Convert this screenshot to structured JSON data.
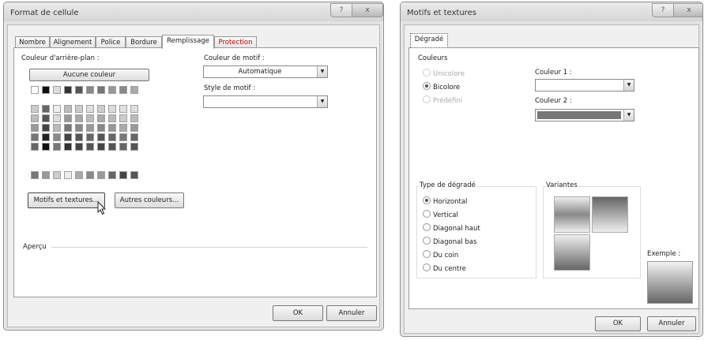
{
  "left_dialog": {
    "title": "Format de cellule",
    "help": "?",
    "close": "x",
    "tabs": [
      "Nombre",
      "Alignement",
      "Police",
      "Bordure",
      "Remplissage",
      "Protection"
    ],
    "bg_color_label": "Couleur d'arrière-plan :",
    "no_color_button": "Aucune couleur",
    "pattern_color_label": "Couleur de motif :",
    "pattern_color_value": "Automatique",
    "pattern_style_label": "Style de motif :",
    "pattern_style_value": "",
    "fill_effects_button": "Motifs et textures...",
    "more_colors_button": "Autres couleurs...",
    "preview_label": "Aperçu",
    "ok": "OK",
    "cancel": "Annuler"
  },
  "right_dialog": {
    "title": "Motifs et textures",
    "help": "?",
    "close": "x",
    "tab": "Dégradé",
    "colors_group": "Couleurs",
    "one_color": "Unicolore",
    "two_colors": "Bicolore",
    "preset": "Prédéfini",
    "color1_label": "Couleur 1 :",
    "color2_label": "Couleur 2 :",
    "shading_group": "Type de dégradé",
    "shading_styles": [
      "Horizontal",
      "Vertical",
      "Diagonal haut",
      "Diagonal bas",
      "Du coin",
      "Du centre"
    ],
    "variants_label": "Variantes",
    "sample_label": "Exemple :",
    "ok": "OK",
    "cancel": "Annuler"
  }
}
